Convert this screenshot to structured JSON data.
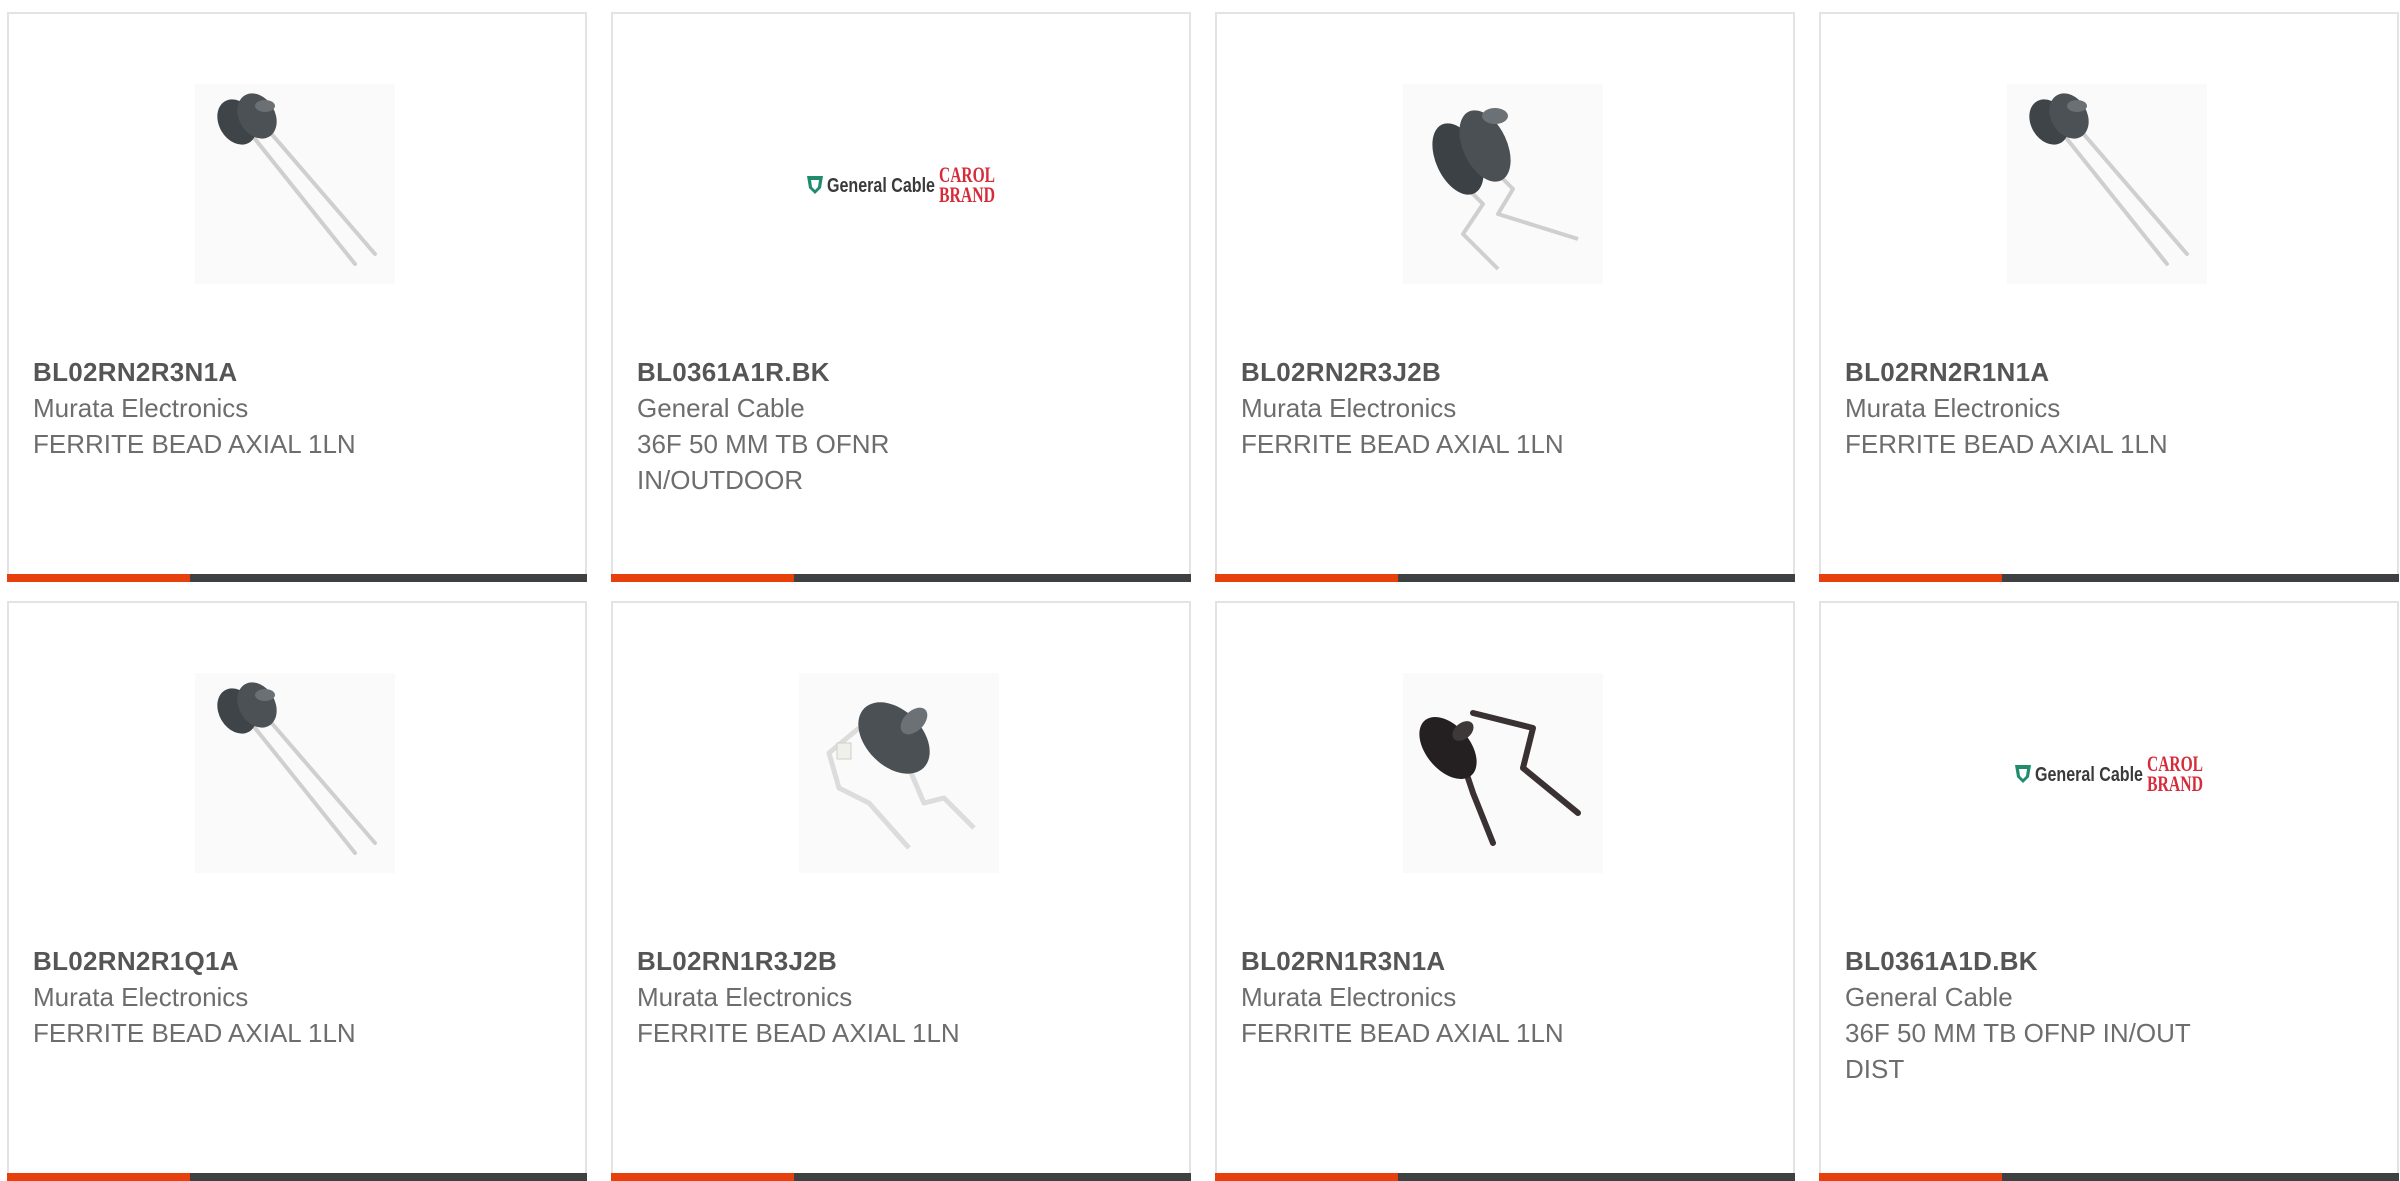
{
  "products": [
    {
      "part_number": "BL02RN2R3N1A",
      "manufacturer": "Murata Electronics",
      "description": "FERRITE BEAD AXIAL 1LN",
      "image": "ferrite-bead-double-icon"
    },
    {
      "part_number": "BL0361A1R.BK",
      "manufacturer": "General Cable",
      "description": "36F 50 MM TB OFNR IN/OUTDOOR",
      "image": "general-cable-carol-brand-logo",
      "logo": {
        "left": "General Cable",
        "right_top": "CAROL",
        "right_bottom": "BRAND"
      }
    },
    {
      "part_number": "BL02RN2R3J2B",
      "manufacturer": "Murata Electronics",
      "description": "FERRITE BEAD AXIAL 1LN",
      "image": "ferrite-bead-kinked-icon"
    },
    {
      "part_number": "BL02RN2R1N1A",
      "manufacturer": "Murata Electronics",
      "description": "FERRITE BEAD AXIAL 1LN",
      "image": "ferrite-bead-double-icon"
    },
    {
      "part_number": "BL02RN2R1Q1A",
      "manufacturer": "Murata Electronics",
      "description": "FERRITE BEAD AXIAL 1LN",
      "image": "ferrite-bead-double-icon"
    },
    {
      "part_number": "BL02RN1R3J2B",
      "manufacturer": "Murata Electronics",
      "description": "FERRITE BEAD AXIAL 1LN",
      "image": "ferrite-bead-single-kinked-icon"
    },
    {
      "part_number": "BL02RN1R3N1A",
      "manufacturer": "Murata Electronics",
      "description": "FERRITE BEAD AXIAL 1LN",
      "image": "ferrite-bead-black-icon"
    },
    {
      "part_number": "BL0361A1D.BK",
      "manufacturer": "General Cable",
      "description": "36F 50 MM TB OFNP IN/OUT DIST",
      "image": "general-cable-carol-brand-logo",
      "logo": {
        "left": "General Cable",
        "right_top": "CAROL",
        "right_bottom": "BRAND"
      }
    }
  ],
  "colors": {
    "accent": "#e8400c",
    "bar": "#3f4042",
    "border": "#e3e3e3",
    "text": "#6d6d6d"
  }
}
